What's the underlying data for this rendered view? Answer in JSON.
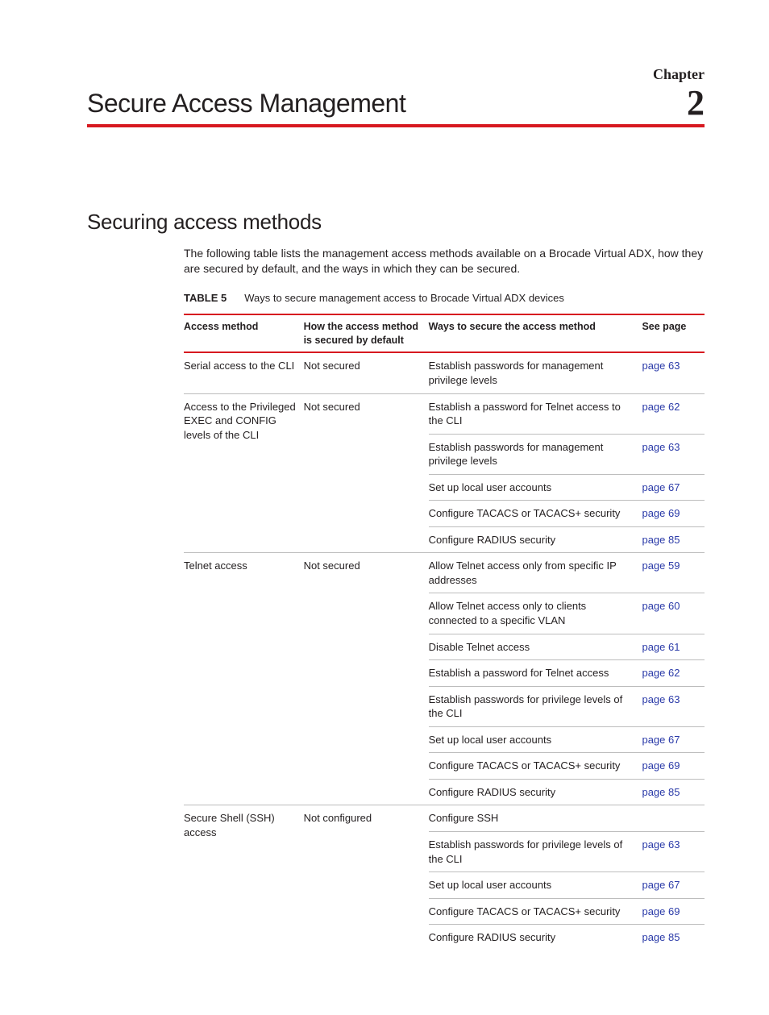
{
  "header": {
    "chapter_label": "Chapter",
    "chapter_number": "2",
    "chapter_title": "Secure Access Management"
  },
  "section": {
    "title": "Securing access methods",
    "intro": "The following table lists the management access methods available on a Brocade Virtual ADX, how they are secured by default, and the ways in which they can be secured."
  },
  "table": {
    "number": "TABLE 5",
    "caption": "Ways to secure management access to Brocade Virtual ADX devices",
    "columns": {
      "c1": "Access method",
      "c2": "How the access method is secured by default",
      "c3": "Ways to secure the access method",
      "c4": "See page"
    },
    "rows": [
      {
        "method": "Serial access to the CLI",
        "default": "Not secured",
        "ways": [
          {
            "text": "Establish passwords for management privilege levels",
            "page": "page 63"
          }
        ]
      },
      {
        "method": "Access to the Privileged EXEC and CONFIG levels of the CLI",
        "default": "Not secured",
        "ways": [
          {
            "text": "Establish a password for Telnet access to the CLI",
            "page": "page 62"
          },
          {
            "text": "Establish passwords for management privilege levels",
            "page": "page 63"
          },
          {
            "text": "Set up local user accounts",
            "page": "page 67"
          },
          {
            "text": "Configure TACACS or TACACS+ security",
            "page": "page 69"
          },
          {
            "text": "Configure RADIUS security",
            "page": "page 85"
          }
        ]
      },
      {
        "method": "Telnet access",
        "default": "Not secured",
        "ways": [
          {
            "text": "Allow Telnet access only from specific IP addresses",
            "page": "page 59"
          },
          {
            "text": "Allow Telnet access only to clients connected to a specific VLAN",
            "page": "page 60"
          },
          {
            "text": "Disable Telnet access",
            "page": "page 61"
          },
          {
            "text": "Establish a password for Telnet access",
            "page": "page 62"
          },
          {
            "text": "Establish passwords for privilege levels of the CLI",
            "page": "page 63"
          },
          {
            "text": "Set up local user accounts",
            "page": "page 67"
          },
          {
            "text": "Configure TACACS or TACACS+ security",
            "page": "page 69"
          },
          {
            "text": "Configure RADIUS security",
            "page": "page 85"
          }
        ]
      },
      {
        "method": "Secure Shell (SSH) access",
        "default": "Not configured",
        "ways": [
          {
            "text": "Configure SSH",
            "page": ""
          },
          {
            "text": "Establish passwords for privilege levels of the CLI",
            "page": "page 63"
          },
          {
            "text": "Set up local user accounts",
            "page": "page 67"
          },
          {
            "text": "Configure TACACS or TACACS+ security",
            "page": "page 69"
          },
          {
            "text": "Configure RADIUS security",
            "page": "page 85"
          }
        ]
      }
    ]
  }
}
